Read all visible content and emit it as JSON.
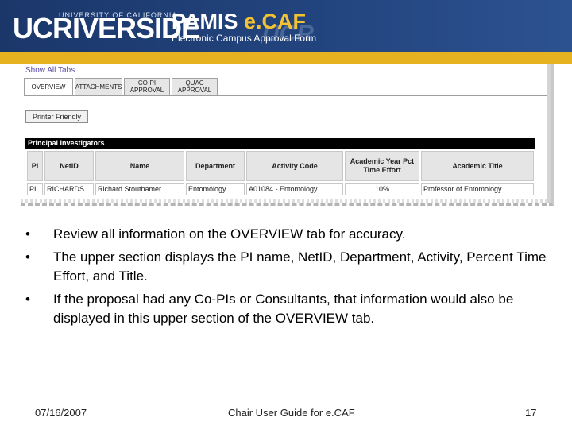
{
  "header": {
    "uc_logo": "UCRIVERSIDE",
    "university_line": "UNIVERSITY OF CALIFORNIA",
    "pamis_title": "PAMIS",
    "ecaf_title": "e.CAF",
    "subtitle": "Electronic Campus Approval Form",
    "watermark": "UCR",
    "colors": {
      "banner": "#1d3a6e",
      "gold": "#e7b21f"
    }
  },
  "screenshot": {
    "show_all_tabs": "Show All Tabs",
    "tabs": [
      {
        "label": "OVERVIEW",
        "active": true
      },
      {
        "label": "ATTACHMENTS",
        "active": false
      },
      {
        "label": "CO-PI APPROVAL",
        "active": false
      },
      {
        "label": "QUAC APPROVAL",
        "active": false
      }
    ],
    "printer_friendly": "Printer Friendly",
    "section_title": "Principal Investigators",
    "table": {
      "headers": [
        "PI",
        "NetID",
        "Name",
        "Department",
        "Activity Code",
        "Academic Year Pct Time Effort",
        "Academic Title"
      ],
      "rows": [
        [
          "PI",
          "RICHARDS",
          "Richard Stouthamer",
          "Entomology",
          "A01084 - Entomology",
          "10%",
          "Professor of Entomology"
        ]
      ]
    }
  },
  "bullets": [
    "Review all information on the OVERVIEW tab for accuracy.",
    "The upper section displays the PI name, NetID, Department, Activity, Percent Time Effort, and Title.",
    "If the proposal had any Co-PIs or Consultants, that information would also be displayed in this upper section of the OVERVIEW tab."
  ],
  "bullet_symbol": "•",
  "footer": {
    "date": "07/16/2007",
    "title": "Chair User Guide for e.CAF",
    "page": "17"
  }
}
